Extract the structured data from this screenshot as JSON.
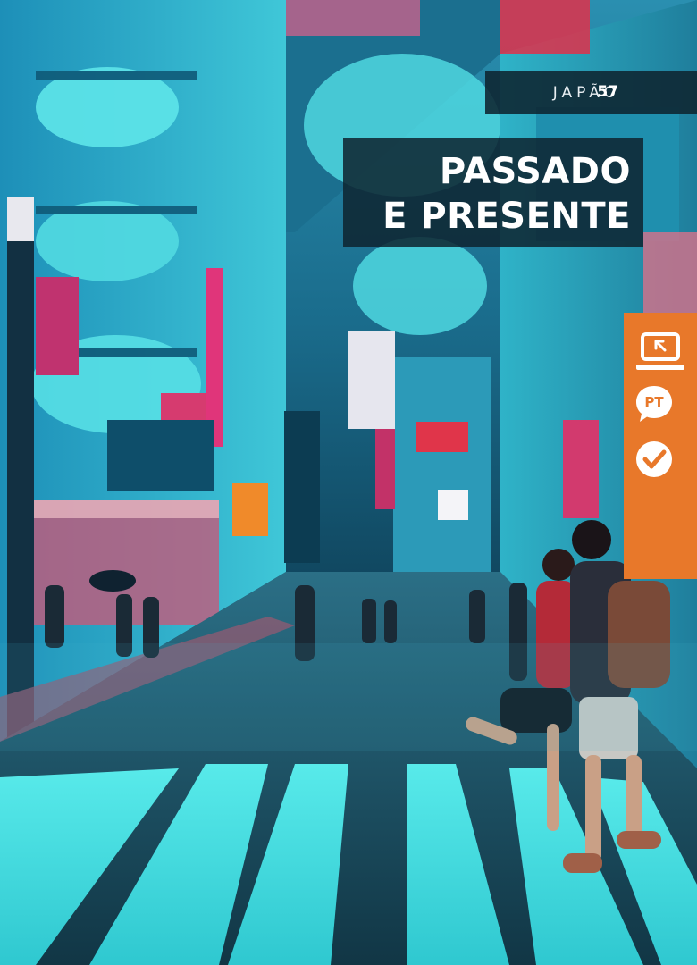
{
  "header": {
    "section_label": "JAPÃO",
    "page_number": "57"
  },
  "title": {
    "line1": "PASSADO",
    "line2": "E PRESENTE"
  },
  "side_panel": {
    "color": "#e8782a",
    "icons": [
      "laptop-icon",
      "pt-badge-icon",
      "check-circle-icon"
    ],
    "badge_text": "PT"
  },
  "colors": {
    "header_bg": "#0e2430",
    "accent_orange": "#e8782a",
    "neon_cyan": "#3fe0e6",
    "neon_magenta": "#e0357a"
  }
}
